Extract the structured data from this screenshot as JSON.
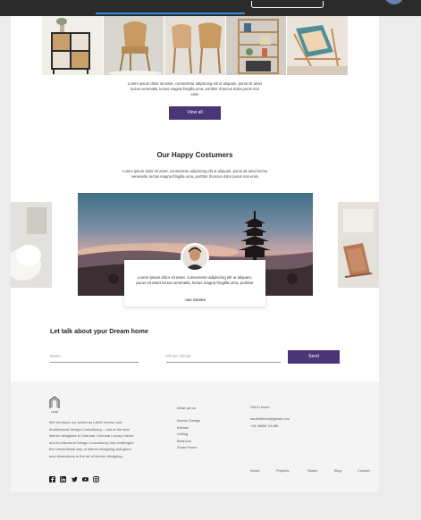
{
  "intro": {
    "text": "Lorem ipsum dolor sit amet, consectetur adipiscing elit ut aliquam, purus sit amet luctus venenatis, lectus magna fringilla urna, porttitor rhoncus dolor purus non enim",
    "view_all_label": "View all"
  },
  "testimonials": {
    "title": "Our Happy Costumers",
    "subtitle": "Lorem ipsum dolor sit amet, consectetur adipiscing elit ut aliquam, purus sit amet luctus venenatis, lectus magna fringilla urna, porttitor rhoncus dolor purus non enim",
    "quote": "Lorem ipsum dolor sit amet, consectetur adipiscing elit ut aliquam, purus sit amet luctus venenatis, lectus magna fringilla urna, porttitor",
    "author": "-Jas Stanke"
  },
  "contact": {
    "title": "Let talk about ypur Dream home",
    "name_placeholder": "Name",
    "phone_placeholder": "Phone / Email",
    "send_label": "Send"
  },
  "footer": {
    "logo_text": "LAND",
    "about": "We introduce our selves as LAND Interior and Architectural Design Consultancy – one of the best interior designers in Chennai. Chennai Luxury Interior and Architectural Design Consultancy has challenged the conventional way of interior designing and given new dimensions to the art of interior designing.",
    "what_we_do_title": "What we do",
    "what_we_do": [
      "Interior Design",
      "Kitchen",
      "Ceiling",
      "Bedroom",
      "Smart Home"
    ],
    "get_in_touch_title": "Get in touch",
    "email": "landinteriors@gmail.com",
    "phone": "+91 98867 91456",
    "nav": [
      "About",
      "Projects",
      "Studio",
      "Blog",
      "Contact"
    ],
    "social_icons": [
      "facebook-icon",
      "linkedin-icon",
      "twitter-icon",
      "youtube-icon",
      "instagram-icon"
    ]
  },
  "colors": {
    "accent": "#4a3577",
    "topbar": "#2b2b2b",
    "tab_underline": "#2d8fe6"
  }
}
